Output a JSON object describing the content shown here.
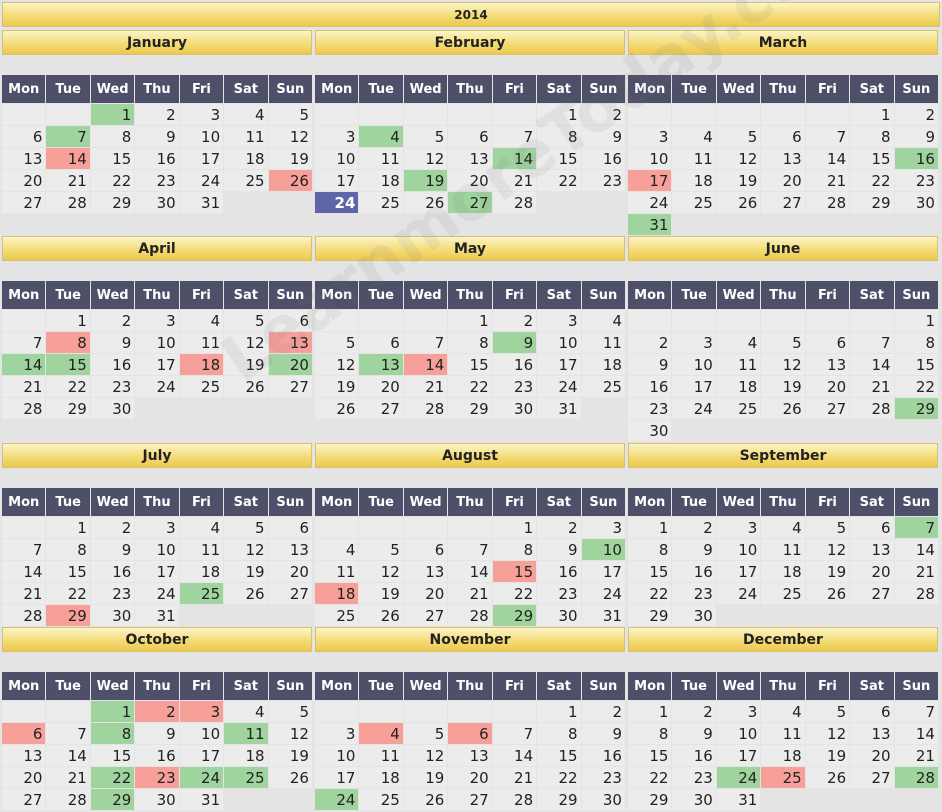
{
  "year": "2014",
  "weekdays": [
    "Mon",
    "Tue",
    "Wed",
    "Thu",
    "Fri",
    "Sat",
    "Sun"
  ],
  "watermark": "LearnmoreToday.com",
  "months": [
    {
      "name": "January",
      "start": 2,
      "days": 31,
      "green": [
        1,
        7
      ],
      "red": [
        14,
        26
      ],
      "today": []
    },
    {
      "name": "February",
      "start": 5,
      "days": 28,
      "green": [
        4,
        14,
        19,
        27
      ],
      "red": [],
      "today": [
        24
      ]
    },
    {
      "name": "March",
      "start": 5,
      "days": 31,
      "green": [
        16,
        31
      ],
      "red": [
        17
      ],
      "today": []
    },
    {
      "name": "April",
      "start": 1,
      "days": 30,
      "green": [
        14,
        15,
        20
      ],
      "red": [
        8,
        13,
        18
      ],
      "today": []
    },
    {
      "name": "May",
      "start": 3,
      "days": 31,
      "green": [
        9,
        13
      ],
      "red": [
        14
      ],
      "today": []
    },
    {
      "name": "June",
      "start": 6,
      "days": 30,
      "green": [
        29
      ],
      "red": [],
      "today": []
    },
    {
      "name": "July",
      "start": 1,
      "days": 31,
      "green": [
        25
      ],
      "red": [
        29
      ],
      "today": []
    },
    {
      "name": "August",
      "start": 4,
      "days": 31,
      "green": [
        10,
        29
      ],
      "red": [
        15,
        18
      ],
      "today": []
    },
    {
      "name": "September",
      "start": 0,
      "days": 30,
      "green": [
        7
      ],
      "red": [],
      "today": []
    },
    {
      "name": "October",
      "start": 2,
      "days": 31,
      "green": [
        1,
        8,
        11,
        22,
        24,
        25,
        29
      ],
      "red": [
        2,
        3,
        6,
        23
      ],
      "today": []
    },
    {
      "name": "November",
      "start": 5,
      "days": 30,
      "green": [
        24
      ],
      "red": [
        4,
        6
      ],
      "today": []
    },
    {
      "name": "December",
      "start": 0,
      "days": 31,
      "green": [
        24,
        28
      ],
      "red": [
        25
      ],
      "today": []
    }
  ],
  "colors": {
    "header_dark": "#4d5068",
    "highlight_green": "#9fd49f",
    "highlight_red": "#f7a09a",
    "today": "#5f66a8"
  }
}
